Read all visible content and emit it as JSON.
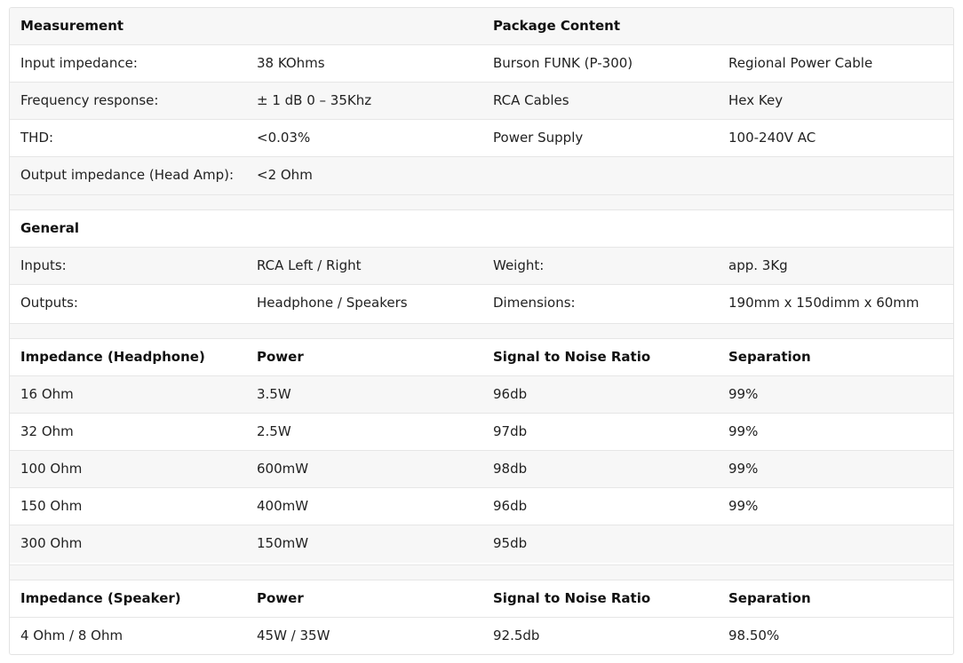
{
  "measurement": {
    "header": {
      "title": "Measurement",
      "package_title": "Package Content"
    },
    "rows": [
      {
        "label": "Input impedance:",
        "value": "38 KOhms",
        "pkg_a": "Burson FUNK (P-300)",
        "pkg_b": "Regional Power Cable"
      },
      {
        "label": "Frequency response:",
        "value": "± 1 dB 0 – 35Khz",
        "pkg_a": "RCA Cables",
        "pkg_b": "Hex Key"
      },
      {
        "label": "THD:",
        "value": "<0.03%",
        "pkg_a": "Power Supply",
        "pkg_b": "100-240V AC"
      },
      {
        "label": "Output impedance (Head Amp):",
        "value": "<2 Ohm",
        "pkg_a": "",
        "pkg_b": ""
      }
    ]
  },
  "general": {
    "title": "General",
    "rows": [
      {
        "label": "Inputs:",
        "value": "RCA Left / Right",
        "label2": "Weight:",
        "value2": "app. 3Kg"
      },
      {
        "label": "Outputs:",
        "value": "Headphone / Speakers",
        "label2": "Dimensions:",
        "value2": "190mm x 150dimm x 60mm"
      }
    ]
  },
  "headphone": {
    "columns": [
      "Impedance (Headphone)",
      "Power",
      "Signal to Noise Ratio",
      "Separation"
    ],
    "rows": [
      [
        "16 Ohm",
        "3.5W",
        "96db",
        "99%"
      ],
      [
        "32 Ohm",
        "2.5W",
        "97db",
        "99%"
      ],
      [
        "100 Ohm",
        "600mW",
        "98db",
        "99%"
      ],
      [
        "150 Ohm",
        "400mW",
        "96db",
        "99%"
      ],
      [
        "300 Ohm",
        "150mW",
        "95db",
        ""
      ]
    ]
  },
  "speaker": {
    "columns": [
      "Impedance (Speaker)",
      "Power",
      "Signal to Noise Ratio",
      "Separation"
    ],
    "rows": [
      [
        "4 Ohm / 8 Ohm",
        "45W / 35W",
        "92.5db",
        "98.50%"
      ]
    ]
  }
}
